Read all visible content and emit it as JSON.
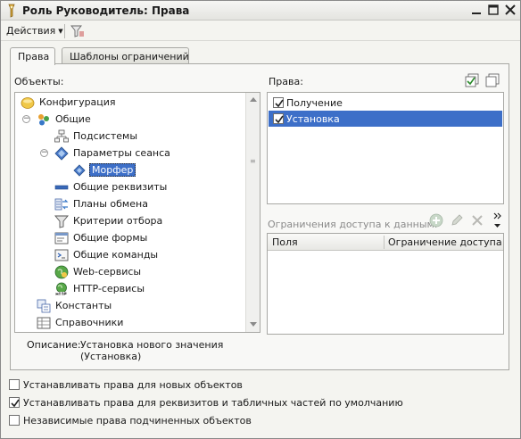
{
  "window": {
    "title": "Роль Руководитель: Права"
  },
  "toolbar": {
    "actions_label": "Действия"
  },
  "tabs": [
    {
      "label": "Права",
      "active": true
    },
    {
      "label": "Шаблоны ограничений",
      "active": false
    }
  ],
  "objects_panel": {
    "label": "Объекты:",
    "tree": [
      {
        "label": "Конфигурация",
        "icon": "configuration-icon"
      },
      {
        "label": "Общие",
        "icon": "common-icon",
        "expanded": true
      },
      {
        "label": "Подсистемы",
        "icon": "subsystems-icon"
      },
      {
        "label": "Параметры сеанса",
        "icon": "session-params-icon",
        "expanded": true
      },
      {
        "label": "Морфер",
        "icon": "session-param-icon",
        "selected": true
      },
      {
        "label": "Общие реквизиты",
        "icon": "common-attributes-icon"
      },
      {
        "label": "Планы обмена",
        "icon": "exchange-plans-icon"
      },
      {
        "label": "Критерии отбора",
        "icon": "filter-criteria-icon"
      },
      {
        "label": "Общие формы",
        "icon": "common-forms-icon"
      },
      {
        "label": "Общие команды",
        "icon": "common-commands-icon"
      },
      {
        "label": "Web-сервисы",
        "icon": "web-services-icon"
      },
      {
        "label": "HTTP-сервисы",
        "icon": "http-services-icon"
      },
      {
        "label": "Константы",
        "icon": "constants-icon"
      },
      {
        "label": "Справочники",
        "icon": "catalogs-icon"
      }
    ]
  },
  "rights_panel": {
    "label": "Права:",
    "items": [
      {
        "label": "Получение",
        "checked": true,
        "selected": false
      },
      {
        "label": "Установка",
        "checked": true,
        "selected": true
      }
    ]
  },
  "restrictions": {
    "label": "Ограничения доступа к данным:",
    "columns": [
      "Поля",
      "Ограничение доступа"
    ]
  },
  "description": {
    "label": "Описание:",
    "line1": "Установка нового значения",
    "line2": "(Установка)"
  },
  "options": [
    {
      "label": "Устанавливать права для новых объектов",
      "checked": false
    },
    {
      "label": "Устанавливать права для реквизитов и табличных частей по умолчанию",
      "checked": true
    },
    {
      "label": "Независимые права подчиненных объектов",
      "checked": false
    }
  ]
}
